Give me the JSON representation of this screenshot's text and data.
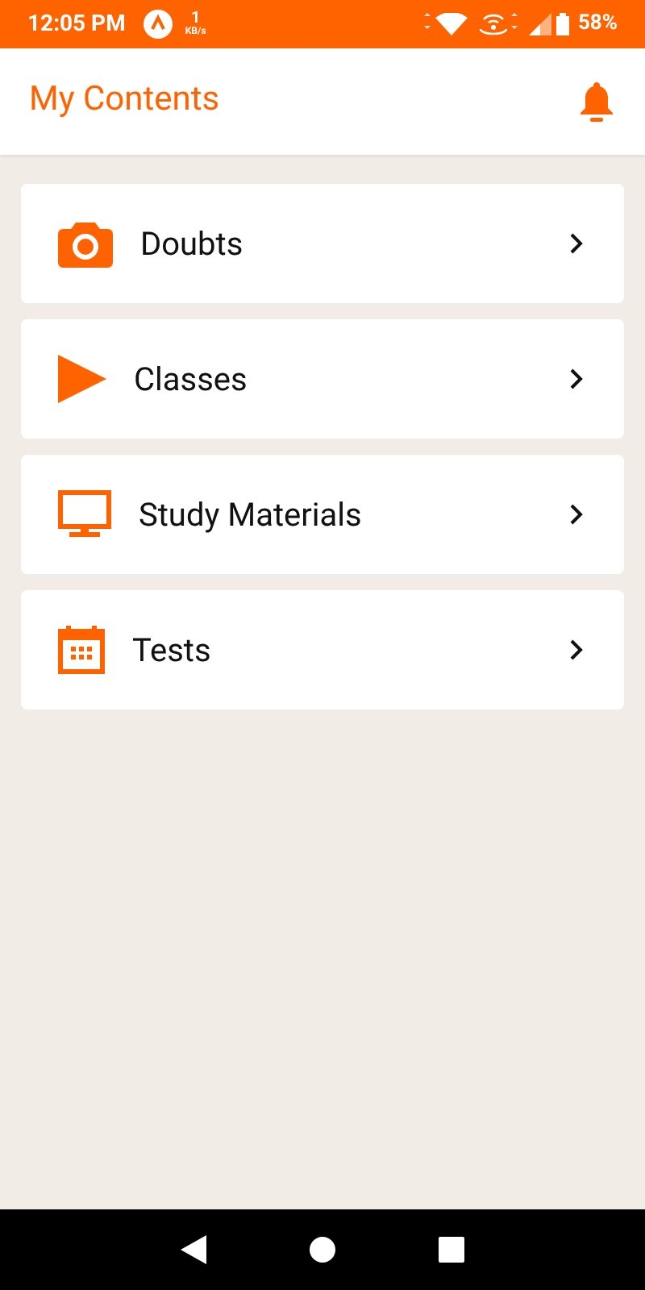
{
  "status_bar": {
    "time": "12:05 PM",
    "speed_value": "1",
    "speed_unit": "KB/s",
    "battery": "58%"
  },
  "header": {
    "title": "My Contents"
  },
  "items": [
    {
      "label": "Doubts",
      "kind": "camera"
    },
    {
      "label": "Classes",
      "kind": "play"
    },
    {
      "label": "Study Materials",
      "kind": "monitor"
    },
    {
      "label": "Tests",
      "kind": "calendar"
    }
  ]
}
